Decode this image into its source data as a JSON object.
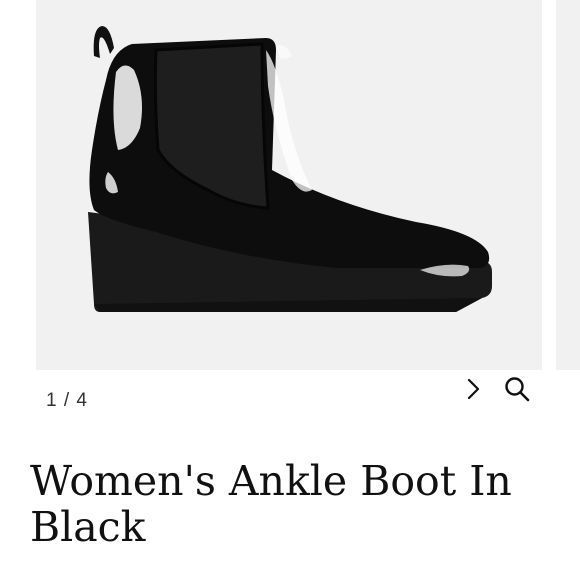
{
  "gallery": {
    "counter": "1 / 4",
    "next_icon": "chevron-right-icon",
    "zoom_icon": "search-icon",
    "image_alt": "Black patent wedge ankle boot"
  },
  "product": {
    "title": "Women's Ankle Boot In Black"
  },
  "colors": {
    "image_background": "#f1f1f1",
    "boot": "#0d0d0d",
    "text": "#111111"
  }
}
